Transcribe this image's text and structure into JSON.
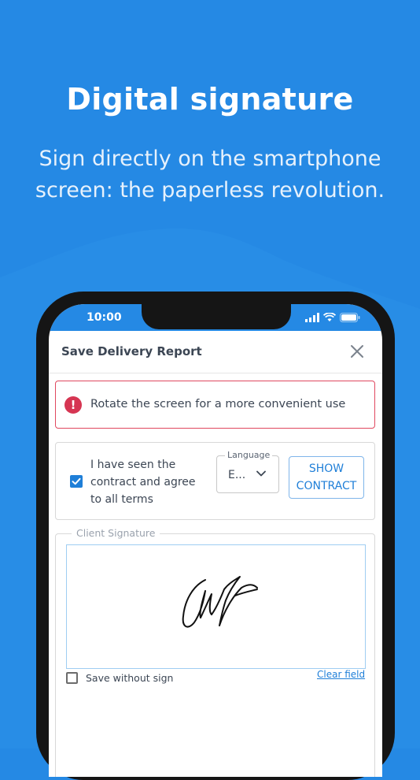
{
  "promo": {
    "title": "Digital signature",
    "subtitle_line1": "Sign directly on the smartphone",
    "subtitle_line2": "screen: the paperless revolution."
  },
  "status_bar": {
    "time": "10:00",
    "icons": [
      "signal-icon",
      "wifi-icon",
      "battery-icon"
    ]
  },
  "modal": {
    "title": "Save Delivery Report",
    "close_icon": "close-icon"
  },
  "alert": {
    "icon": "alert-circle-icon",
    "message": "Rotate the screen for a more convenient use"
  },
  "terms": {
    "checked": true,
    "line1": "I have seen the",
    "line2": "contract and agree",
    "line3": "to all terms",
    "language_label": "Language",
    "language_value": "E...",
    "show_contract_line1": "SHOW",
    "show_contract_line2": "CONTRACT"
  },
  "signature": {
    "legend": "Client Signature",
    "save_without_sign_label": "Save without sign",
    "save_without_sign_checked": false,
    "clear_label": "Clear field"
  },
  "colors": {
    "background": "#2589e4",
    "primary": "#1f7fd8",
    "alert_border": "#e0485f",
    "alert_icon": "#d63552"
  }
}
